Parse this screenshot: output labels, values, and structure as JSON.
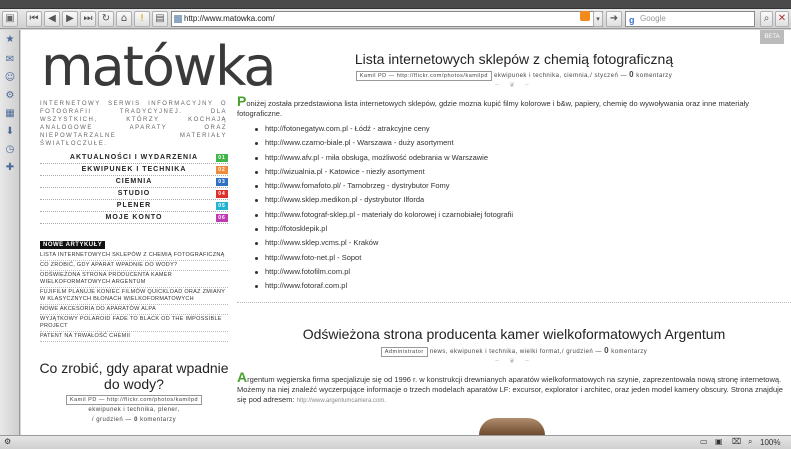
{
  "browser": {
    "url": "http://www.matowka.com/",
    "search_placeholder": "Google",
    "search_engine_glyph": "g",
    "nav_icons": [
      "back-first-icon",
      "back-icon",
      "forward-icon",
      "forward-last-icon",
      "reload-icon",
      "home-icon",
      "exclamation-icon",
      "bookmarks-icon",
      "rss-icon"
    ],
    "sidebar_icons": [
      "star-icon",
      "mail-icon",
      "user-icon",
      "settings-icon",
      "notes-icon",
      "download-icon",
      "clock-icon",
      "add-icon"
    ],
    "zoom": "100%"
  },
  "site": {
    "logo": "matówka",
    "beta_badge": "BETA",
    "tagline": "INTERNETOWY SERWIS INFORMACYJNY O FOTOGRAFII TRADYCYJNEJ. DLA WSZYSTKICH, KTÓRZY KOCHAJĄ ANALOGOWE APARATY ORAZ NIEPOWTARZALNE MATERIAŁY ŚWIATŁOCZUŁE.",
    "nav": [
      {
        "label": "AKTUALNOŚCI I WYDARZENIA",
        "num": "01",
        "color": "#3fb54a"
      },
      {
        "label": "EKWIPUNEK I TECHNIKA",
        "num": "02",
        "color": "#f08a3c"
      },
      {
        "label": "CIEMNIA",
        "num": "03",
        "color": "#2f6fc4"
      },
      {
        "label": "STUDIO",
        "num": "04",
        "color": "#e0302e"
      },
      {
        "label": "PLENER",
        "num": "05",
        "color": "#23b4d2"
      },
      {
        "label": "MOJE KONTO",
        "num": "06",
        "color": "#c23ab2"
      }
    ],
    "new_articles_heading": "NOWE ARTYKUŁY",
    "new_articles": [
      "LISTA INTERNETOWYCH SKLEPÓW Z CHEMIĄ FOTOGRAFICZNĄ",
      "CO ZROBIĆ, GDY APARAT WPADNIE DO WODY?",
      "ODŚWIEŻONA STRONA PRODUCENTA KAMER WIELKOFORMATOWYCH ARGENTUM",
      "FUJIFILM PLANUJE KONIEC FILMÓW QUICKLOAD ORAZ ZMIANY W KLASYCZNYCH BŁONACH WIELKOFORMATOWYCH",
      "NOWE AKCESORIA DO APARATÓW ALPA",
      "WYJĄTKOWY POLAROID FADE TO BLACK OD THE IMPOSSIBLE PROJECT",
      "PATENT NA TRWAŁOŚĆ CHEMII"
    ],
    "left_post": {
      "title": "Co zrobić, gdy aparat wpadnie do wody?",
      "credit": "Kamil PD — http://flickr.com/photos/kamilpd",
      "tags": "ekwipunek i technika, plener,",
      "date": "/ grudzień —",
      "comments_count": "0",
      "comments_label": "komentarzy"
    }
  },
  "posts": [
    {
      "title": "Lista internetowych sklepów z chemią fotograficzną",
      "credit": "Kamil PD — http://flickr.com/photos/kamilpd",
      "tags": "ekwipunek i technika, ciemnia,/ styczeń —",
      "comments_count": "0",
      "comments_label": "komentarzy",
      "ornament": "~ ❦ ~",
      "dropcap": "P",
      "intro": "oniżej została przedstawiona lista internetowych sklepów, gdzie mozna kupić filmy kolorowe i b&w, papiery, chemię do wywoływania oraz inne materiały fotograficzne.",
      "links": [
        "http://fotonegatyw.com.pl - Łódź - atrakcyjne ceny",
        "http://www.czarno-biale.pl - Warszawa - duży asortyment",
        "http://www.afv.pl - miła obsługa, możliwość odebrania w Warszawie",
        "http://wizualnia.pl - Katowice - niezły asortyment",
        "http://www.fomafoto.pl/ - Tarnobrzeg - dystrybutor Fomy",
        "http://www.sklep.medikon.pl - dystrybutor Ilforda",
        "http://www.fotograf-sklep.pl - materiały do kolorowej i czarnobiałej fotografii",
        "http://fotosklepik.pl",
        "http://www.sklep.vcms.pl - Kraków",
        "http://www.foto-net.pl - Sopot",
        "http://www.fotofilm.com.pl",
        "http://www.fotoraf.com.pl"
      ]
    },
    {
      "title": "Odświeżona strona producenta kamer wielkoformatowych Argentum",
      "credit": "Administrator",
      "tags": "news, ekwipunek i technika, wielki format,/ grudzień —",
      "comments_count": "0",
      "comments_label": "komentarzy",
      "ornament": "~ ❦ ~",
      "dropcap": "A",
      "intro": "rgentum węgierska firma specjalizuje się od 1996 r. w konstrukcji drewnianych aparatów wielkoformatowych na szynie, zaprezentowała nową stronę internetową. Możemy na niej znaleźć wyczerpujące informacje o trzech modelach aparatów LF: excursor, explorator i architec, oraz jeden model kamery obscury. Strona znajduje się pod adresem:",
      "link": "http://www.argentumcamera.com."
    }
  ]
}
